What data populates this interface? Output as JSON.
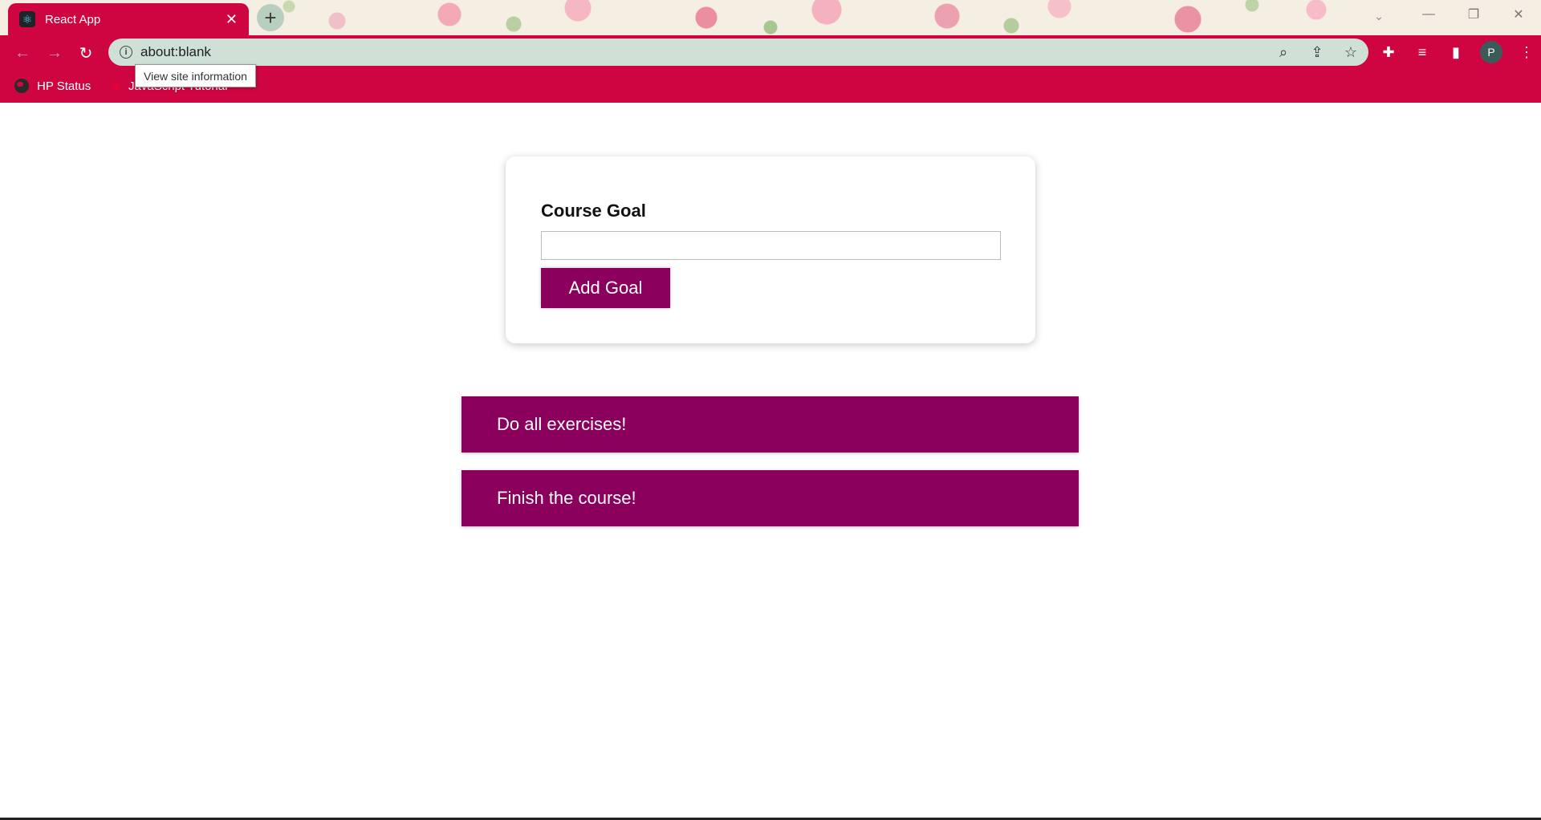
{
  "browser": {
    "tab": {
      "title": "React App",
      "favicon": "react-logo-icon",
      "close": "✕"
    },
    "new_tab": "+",
    "omnibox": {
      "url": "about:blank",
      "tooltip": "View site information"
    },
    "bookmarks": [
      {
        "label": "HP Status",
        "icon": "globe-icon"
      },
      {
        "label": "JavaScript Tutorial",
        "icon": "bookmark-icon"
      }
    ],
    "avatar_letter": "P",
    "accent_color": "#ce0541"
  },
  "form": {
    "label": "Course Goal",
    "input_value": "",
    "button_label": "Add Goal",
    "button_color": "#8b005d"
  },
  "goals": [
    {
      "text": "Do all exercises!"
    },
    {
      "text": "Finish the course!"
    }
  ]
}
